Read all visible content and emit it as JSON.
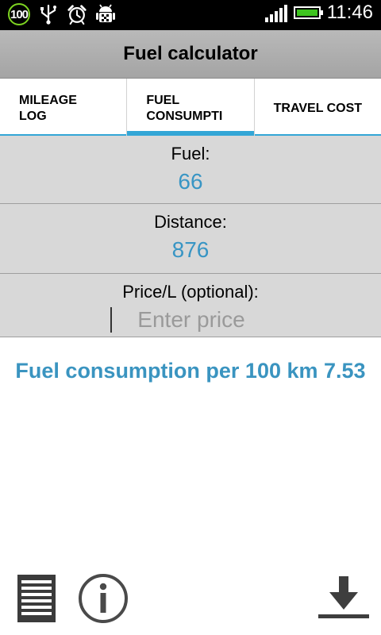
{
  "status_bar": {
    "notification_badge": "100",
    "icons": [
      "usb-icon",
      "alarm-clock-icon",
      "android-debug-icon"
    ],
    "signal_bars": 5,
    "battery_level": 1.0,
    "battery_color": "#3ec41f",
    "time": "11:46"
  },
  "app": {
    "title": "Fuel calculator"
  },
  "tabs": [
    {
      "label": "MILEAGE\nLOG",
      "active": false
    },
    {
      "label": "FUEL\nCONSUMPTI",
      "active": true
    },
    {
      "label": "TRAVEL COST",
      "active": false
    }
  ],
  "form": {
    "fuel_label": "Fuel:",
    "fuel_value": "66",
    "distance_label": "Distance:",
    "distance_value": "876",
    "price_label": "Price/L (optional):",
    "price_value": "",
    "price_placeholder": "Enter price"
  },
  "result": {
    "text": "Fuel consumption per 100 km 7.53"
  },
  "bottom_bar": {
    "icons": [
      "list-icon",
      "info-icon",
      "download-icon"
    ]
  },
  "colors": {
    "accent": "#33a6d6",
    "value_text": "#3895c4",
    "result_text": "#3a94c0",
    "row_background": "#d8d8d8"
  }
}
